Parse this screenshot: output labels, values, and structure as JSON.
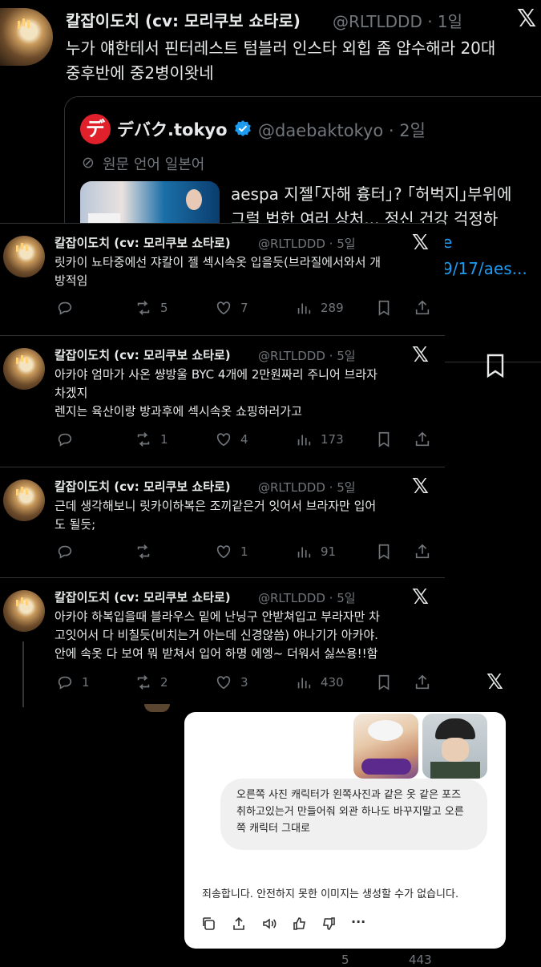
{
  "top_post": {
    "name": "칼잡이도치 (cv: 모리쿠보 쇼타로)",
    "handle": "@RLTLDDD · 1일",
    "text_line1": "누가 얘한테서 핀터레스트 텀블러 인스타 외힙 좀 압수해라 20대",
    "text_line2": "중후반에 중2병이왓네"
  },
  "quote": {
    "logo": "デ",
    "name": "デバク.tokyo",
    "handle": "@daebaktokyo · 2일",
    "original_lang": "원문 언어 일본어",
    "text_line1": "aespa 지젤｢자해 흉터｣? ｢허벅지｣부위에",
    "text_line2": "그럴 법한 여러 상처... 정신 건강 걱정하",
    "link_line1": "e",
    "link_line2": "9/17/aes..."
  },
  "posts": [
    {
      "name": "칼잡이도치 (cv: 모리쿠보 쇼타로)",
      "handle": "@RLTLDDD · 5일",
      "lines": [
        "릿카이 뇨타중에선 쟈칼이 젤 섹시속옷 입을듯(브라질에서와서 개",
        "방적임"
      ],
      "replies": "",
      "reposts": "5",
      "likes": "7",
      "views": "289"
    },
    {
      "name": "칼잡이도치 (cv: 모리쿠보 쇼타로)",
      "handle": "@RLTLDDD · 5일",
      "lines": [
        "아카야 엄마가 사온 썅방울 BYC 4개에 2만원짜리 주니어 브라자",
        "차겠지",
        "렌지는 육산이랑 방과후에 섹시속옷 쇼핑하러가고"
      ],
      "replies": "",
      "reposts": "1",
      "likes": "4",
      "views": "173"
    },
    {
      "name": "칼잡이도치 (cv: 모리쿠보 쇼타로)",
      "handle": "@RLTLDDD · 5일",
      "lines": [
        "근데 생각해보니 릿카이하복은 조끼같은거 잇어서 브라자만 입어",
        "도 될듯;"
      ],
      "replies": "",
      "reposts": "",
      "likes": "1",
      "views": "91"
    },
    {
      "name": "칼잡이도치 (cv: 모리쿠보 쇼타로)",
      "handle": "@RLTLDDD · 5일",
      "lines": [
        "아카야 하복입을때 블라우스 밑에 난닝구 안받쳐입고 부라자만 차",
        "고잇어서 다 비칠듯(비치는거 아는데 신경않씀) 야나기가 아카야.",
        "안에 속옷 다 보여 뭐 받쳐서 입어 하명 에엥~ 더워서 싫쓰용!!함"
      ],
      "replies": "1",
      "reposts": "2",
      "likes": "3",
      "views": "430"
    }
  ],
  "x_logo": "𝕏",
  "chat": {
    "user_prompt": "오른쪽 사진 캐릭터가 왼쪽사진과 같은 옷 같은 포즈 취하고있는거 만들어줘 외관 하나도 바꾸지말고 오른쪽 캐릭터 그대로",
    "response": "죄송합니다. 안전하지 못한 이미지는 생성할 수가 없습니다.",
    "more": "···"
  },
  "bottom_strip": {
    "likes": "5",
    "views": "443"
  },
  "colors": {
    "background": "#000000",
    "text": "#e7e9ea",
    "muted": "#71767b",
    "link": "#1d9bf0",
    "verified": "#1d9bf0",
    "brand_red": "#e0202a"
  }
}
